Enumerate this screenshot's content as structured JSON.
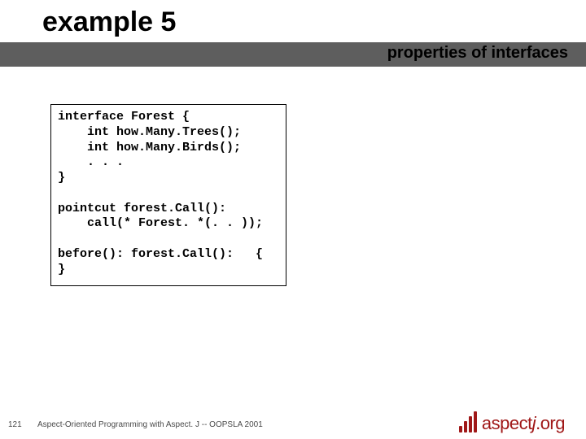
{
  "title": "example 5",
  "subtitle": "properties of interfaces",
  "code": "interface Forest {\n    int how.Many.Trees();\n    int how.Many.Birds();\n    . . .\n}\n\npointcut forest.Call():\n    call(* Forest. *(. . ));\n\nbefore(): forest.Call():   {\n}",
  "footer": "Aspect-Oriented Programming with Aspect. J -- OOPSLA 2001",
  "slide_number": "121",
  "logo": {
    "text_left": "aspect",
    "text_j": "j",
    "text_right": ".org"
  }
}
